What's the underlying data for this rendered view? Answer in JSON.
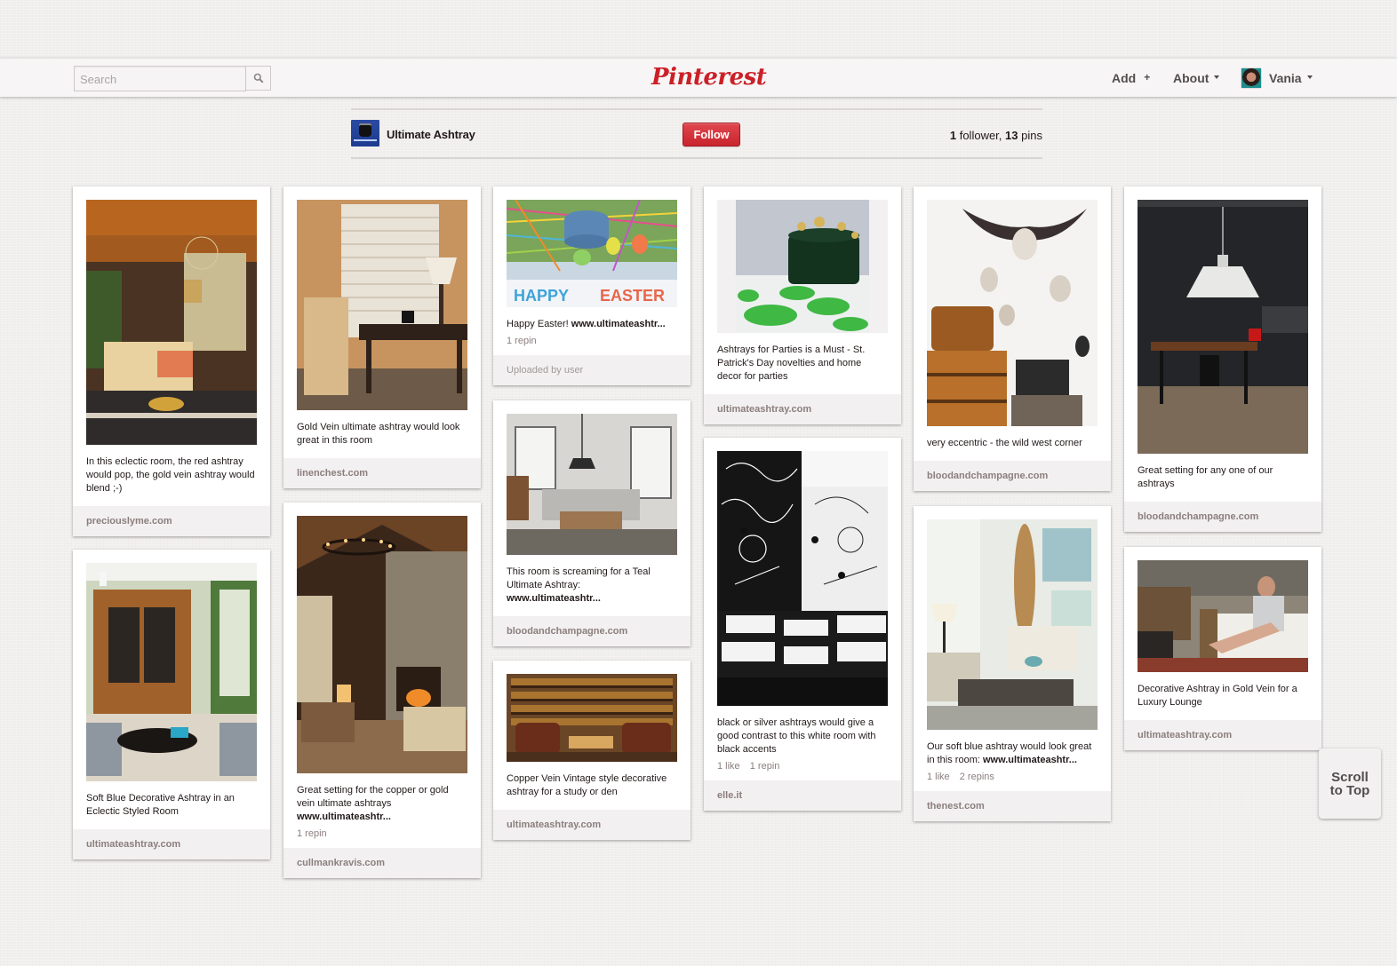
{
  "header": {
    "search": {
      "placeholder": "Search",
      "value": "",
      "icon": "search-icon"
    },
    "logo": "Pinterest",
    "nav": {
      "add_label": "Add",
      "add_icon": "+",
      "about_label": "About",
      "user_label": "Vania"
    }
  },
  "board": {
    "name": "Ultimate Ashtray",
    "follow_label": "Follow",
    "followers_count": "1",
    "followers_label": "follower,",
    "pins_count": "13",
    "pins_label": "pins"
  },
  "colors": {
    "brand": "#cb2027",
    "background": "#f0efee",
    "card_footer": "#f2f0f0",
    "source_text": "#8c7e7e"
  },
  "pins": [
    {
      "description": "In this eclectic room, the red ashtray would pop, the gold vein ashtray would blend ;-)",
      "link": "",
      "stats": [],
      "source": "preciouslyme.com",
      "image": "eclectic living room"
    },
    {
      "description": "Soft Blue Decorative Ashtray in an Eclectic Styled Room",
      "link": "",
      "stats": [],
      "source": "ultimateashtray.com",
      "image": "room with wooden armoire"
    },
    {
      "description": "Gold Vein ultimate ashtray would look great in this room",
      "link": "",
      "stats": [],
      "source": "linenchest.com",
      "image": "room with shutters and lamp"
    },
    {
      "description": "Great setting for the copper or gold vein ultimate ashtrays",
      "link": "www.ultimateashtr...",
      "stats": [
        "1 repin"
      ],
      "source": "cullmankravis.com",
      "image": "lodge living room with fireplace"
    },
    {
      "description": "Happy Easter!",
      "link": "www.ultimateashtr...",
      "stats": [
        "1 repin"
      ],
      "source": "Uploaded by user",
      "image": "easter basket with blue ashtray"
    },
    {
      "description": "This room is screaming for a Teal Ultimate Ashtray:",
      "link": "www.ultimateashtr...",
      "stats": [],
      "source": "bloodandchampagne.com",
      "image": "loft living room"
    },
    {
      "description": "Copper Vein Vintage style decorative ashtray for a study or den",
      "link": "",
      "stats": [],
      "source": "ultimateashtray.com",
      "image": "library with leather chairs"
    },
    {
      "description": "Ashtrays for Parties is a Must - St. Patrick's Day novelties and home decor for parties",
      "link": "",
      "stats": [],
      "source": "ultimateashtray.com",
      "image": "green pot with shamrocks"
    },
    {
      "description": "black or silver ashtrays would give a good contrast to this white room with black accents",
      "link": "",
      "stats": [
        "1 like",
        "1 repin"
      ],
      "source": "elle.it",
      "image": "black and white restaurant"
    },
    {
      "description": "very eccentric - the wild west corner",
      "link": "",
      "stats": [],
      "source": "bloodandchampagne.com",
      "image": "skulls and leather luggage"
    },
    {
      "description": "Our soft blue ashtray would look great in this room:",
      "link": "www.ultimateashtr...",
      "stats": [
        "1 like",
        "2 repins"
      ],
      "source": "thenest.com",
      "image": "beach living room with surfboard"
    },
    {
      "description": "Great setting for any one of our ashtrays",
      "link": "",
      "stats": [],
      "source": "bloodandchampagne.com",
      "image": "dark dining room with pendant lamp"
    },
    {
      "description": "Decorative Ashtray in Gold Vein for a Luxury Lounge",
      "link": "",
      "stats": [],
      "source": "ultimateashtray.com",
      "image": "woman on lounge sofa"
    }
  ],
  "scroll_top": {
    "line1": "Scroll",
    "line2": "to Top"
  }
}
